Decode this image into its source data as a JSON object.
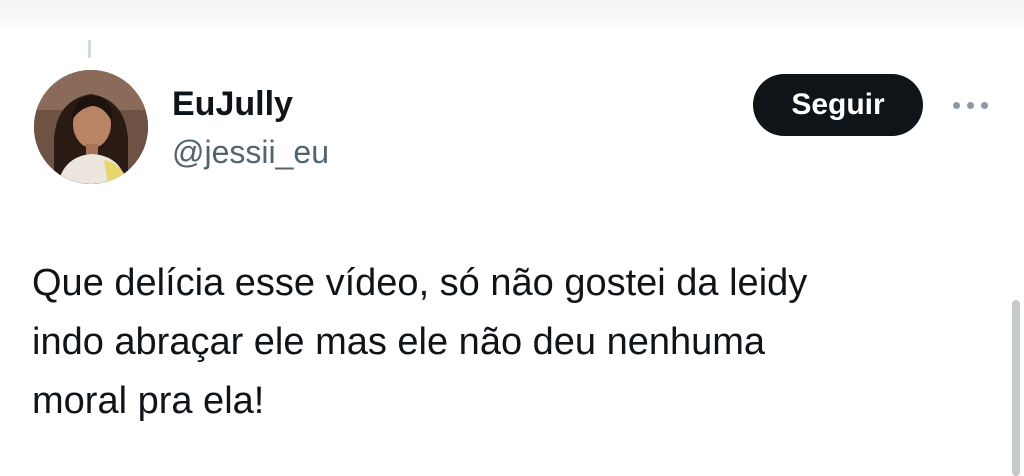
{
  "tweet": {
    "author": {
      "display_name": "EuJully",
      "handle": "@jessii_eu",
      "avatar_icon": "profile-photo-avatar"
    },
    "follow_label": "Seguir",
    "more_icon": "more-options-icon",
    "text": "Que delícia esse vídeo, só não gostei da leidy\nindo abraçar ele mas ele não deu nenhuma\nmoral pra ela!"
  },
  "colors": {
    "text_primary": "#0f1419",
    "text_secondary": "#536471",
    "button_bg": "#0f1419",
    "button_text": "#ffffff",
    "thread_line": "#cfd9de"
  }
}
